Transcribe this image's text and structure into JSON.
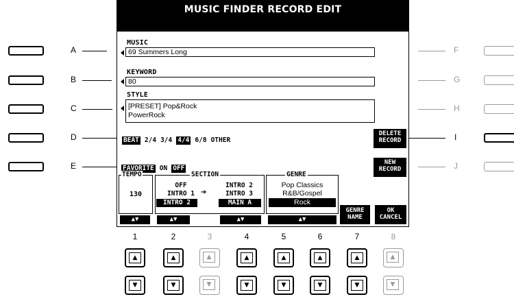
{
  "screen": {
    "title": "MUSIC FINDER RECORD EDIT",
    "music": {
      "label": "MUSIC",
      "value": "69 Summers Long"
    },
    "keyword": {
      "label": "KEYWORD",
      "value": "80"
    },
    "style": {
      "label": "STYLE",
      "line1": "[PRESET]  Pop&Rock",
      "line2": "PowerRock"
    },
    "beat": {
      "label": "BEAT",
      "options": [
        "2/4",
        "3/4",
        "4/4",
        "6/8",
        "OTHER"
      ],
      "selected": "4/4"
    },
    "favorite": {
      "label": "FAVORITE",
      "on": "ON",
      "off": "OFF"
    },
    "tempo": {
      "label": "TEMPO",
      "value": "130"
    },
    "section": {
      "label": "SECTION",
      "left": [
        "OFF",
        "INTRO 1",
        "INTRO 2"
      ],
      "right": [
        "INTRO 2",
        "INTRO 3",
        "MAIN A"
      ],
      "arrow": "➔"
    },
    "genre": {
      "label": "GENRE",
      "items": [
        "Pop Classics",
        "R&B/Gospel",
        "Rock"
      ]
    },
    "right_buttons": {
      "delete": [
        "DELETE",
        "RECORD"
      ],
      "new": [
        "NEW",
        "RECORD"
      ],
      "genre_name": [
        "GENRE",
        "NAME"
      ],
      "ok": "OK",
      "cancel": "CANCEL"
    },
    "up_down_icon": "up-down-arrows"
  },
  "side_left": [
    "A",
    "B",
    "C",
    "D",
    "E"
  ],
  "side_right": [
    "F",
    "G",
    "H",
    "I",
    "J"
  ],
  "bottom_numbers": [
    "1",
    "2",
    "3",
    "4",
    "5",
    "6",
    "7",
    "8"
  ],
  "bottom_dim": [
    false,
    false,
    true,
    false,
    false,
    false,
    false,
    true
  ],
  "up_glyph": "▲",
  "down_glyph": "▼"
}
